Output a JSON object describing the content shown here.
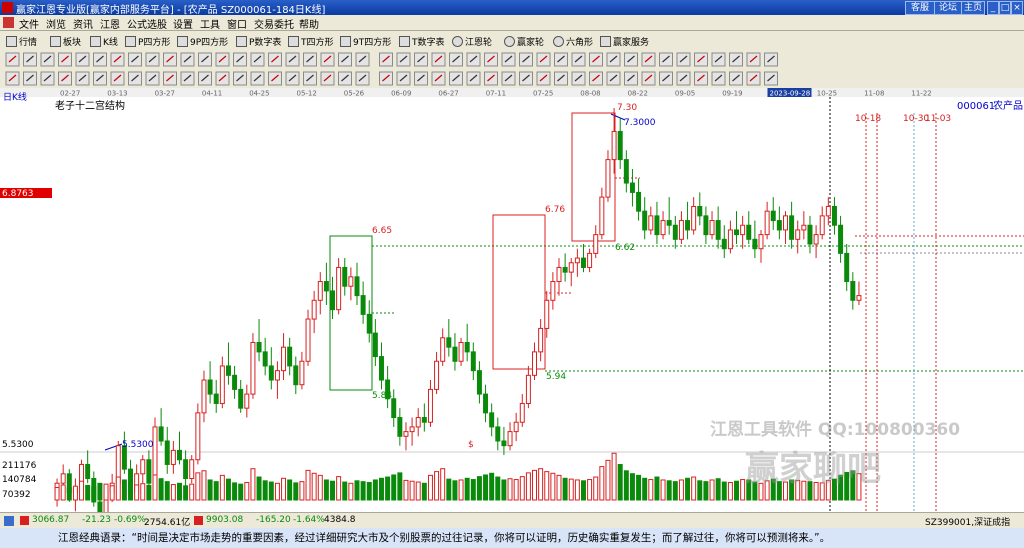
{
  "window": {
    "title": "赢家江恩专业版[赢家内部服务平台] - [农产品  SZ000061-184日K线]",
    "buttons": [
      "客服",
      "论坛",
      "主页"
    ],
    "win_controls": [
      "_",
      "□",
      "×"
    ]
  },
  "menu": [
    "文件",
    "浏览",
    "资讯",
    "江恩",
    "公式选股",
    "设置",
    "工具",
    "窗口",
    "交易委托",
    "帮助"
  ],
  "toolbar1": [
    {
      "icon": "grid-icon",
      "label": "行情"
    },
    {
      "icon": "blocks-icon",
      "label": "板块"
    },
    {
      "icon": "kline-icon",
      "label": "K线"
    },
    {
      "icon": "p-square-icon",
      "label": "P四方形"
    },
    {
      "icon": "9p-square-icon",
      "label": "9P四方形"
    },
    {
      "icon": "p-numtable-icon",
      "label": "P数字表"
    },
    {
      "icon": "t-square-icon",
      "label": "T四方形"
    },
    {
      "icon": "9t-square-icon",
      "label": "9T四方形"
    },
    {
      "icon": "t-numtable-icon",
      "label": "T数字表"
    },
    {
      "icon": "gann-wheel-icon",
      "label": "江恩轮"
    },
    {
      "icon": "winner-wheel-icon",
      "label": "赢家轮"
    },
    {
      "icon": "hexagon-icon",
      "label": "六角形"
    },
    {
      "icon": "service-icon",
      "label": "赢家服务"
    }
  ],
  "chart": {
    "period_label": "日K线",
    "structure_label": "老子十二宫结构",
    "stock_code": "000061",
    "stock_name": "农产品",
    "price_marker": "6.8763",
    "date_axis": [
      "02-27",
      "03-13",
      "03-27",
      "04-11",
      "04-25",
      "05-12",
      "05-26",
      "06-09",
      "06-27",
      "07-11",
      "07-25",
      "08-08",
      "08-22",
      "09-05",
      "09-19",
      "2023-09-28",
      "10-25",
      "11-08",
      "11-22"
    ],
    "future_dates": [
      "10-18",
      "10-30",
      "11-03"
    ],
    "annotations": [
      "7.30",
      "7.3000",
      "6.76",
      "6.65",
      "6.62",
      "5.94",
      "5.84",
      "5.5300",
      "5.5300",
      "$"
    ],
    "volume_ticks": [
      "211176",
      "140784",
      "70392"
    ],
    "chart_data": {
      "type": "candlestick",
      "symbol": "SZ000061",
      "ylim": [
        5.3,
        7.5
      ],
      "candles": [
        [
          5.66,
          5.72,
          5.6,
          5.7
        ],
        [
          5.7,
          5.78,
          5.66,
          5.74
        ],
        [
          5.74,
          5.76,
          5.62,
          5.66
        ],
        [
          5.66,
          5.72,
          5.58,
          5.68
        ],
        [
          5.68,
          5.8,
          5.66,
          5.78
        ],
        [
          5.78,
          5.84,
          5.7,
          5.72
        ],
        [
          5.72,
          5.75,
          5.6,
          5.62
        ],
        [
          5.62,
          5.66,
          5.53,
          5.56
        ],
        [
          5.56,
          5.68,
          5.54,
          5.66
        ],
        [
          5.66,
          5.74,
          5.62,
          5.7
        ],
        [
          5.7,
          5.88,
          5.68,
          5.86
        ],
        [
          5.86,
          5.92,
          5.74,
          5.76
        ],
        [
          5.76,
          5.8,
          5.64,
          5.66
        ],
        [
          5.66,
          5.78,
          5.64,
          5.74
        ],
        [
          5.74,
          5.82,
          5.7,
          5.8
        ],
        [
          5.8,
          5.84,
          5.68,
          5.7
        ],
        [
          5.7,
          5.98,
          5.68,
          5.94
        ],
        [
          5.94,
          6.02,
          5.86,
          5.88
        ],
        [
          5.88,
          5.94,
          5.74,
          5.78
        ],
        [
          5.78,
          5.88,
          5.74,
          5.84
        ],
        [
          5.84,
          5.92,
          5.78,
          5.8
        ],
        [
          5.8,
          5.84,
          5.68,
          5.72
        ],
        [
          5.72,
          5.82,
          5.7,
          5.8
        ],
        [
          5.8,
          6.04,
          5.78,
          6.0
        ],
        [
          6.0,
          6.18,
          5.96,
          6.14
        ],
        [
          6.14,
          6.22,
          6.04,
          6.08
        ],
        [
          6.08,
          6.14,
          6.0,
          6.04
        ],
        [
          6.04,
          6.24,
          6.02,
          6.2
        ],
        [
          6.2,
          6.3,
          6.12,
          6.16
        ],
        [
          6.16,
          6.2,
          6.06,
          6.1
        ],
        [
          6.1,
          6.14,
          6.0,
          6.02
        ],
        [
          6.02,
          6.12,
          5.98,
          6.08
        ],
        [
          6.08,
          6.34,
          6.06,
          6.3
        ],
        [
          6.3,
          6.4,
          6.22,
          6.26
        ],
        [
          6.26,
          6.32,
          6.16,
          6.2
        ],
        [
          6.2,
          6.28,
          6.1,
          6.14
        ],
        [
          6.14,
          6.22,
          6.06,
          6.18
        ],
        [
          6.18,
          6.34,
          6.14,
          6.28
        ],
        [
          6.28,
          6.32,
          6.16,
          6.2
        ],
        [
          6.2,
          6.24,
          6.08,
          6.12
        ],
        [
          6.12,
          6.26,
          6.1,
          6.22
        ],
        [
          6.22,
          6.44,
          6.2,
          6.4
        ],
        [
          6.4,
          6.52,
          6.34,
          6.48
        ],
        [
          6.48,
          6.6,
          6.42,
          6.56
        ],
        [
          6.56,
          6.64,
          6.46,
          6.52
        ],
        [
          6.52,
          6.58,
          6.4,
          6.44
        ],
        [
          6.44,
          6.66,
          6.42,
          6.62
        ],
        [
          6.62,
          6.66,
          6.5,
          6.54
        ],
        [
          6.54,
          6.62,
          6.48,
          6.58
        ],
        [
          6.58,
          6.64,
          6.46,
          6.5
        ],
        [
          6.5,
          6.56,
          6.38,
          6.42
        ],
        [
          6.42,
          6.48,
          6.3,
          6.34
        ],
        [
          6.34,
          6.4,
          6.2,
          6.24
        ],
        [
          6.24,
          6.3,
          6.1,
          6.14
        ],
        [
          6.14,
          6.2,
          6.02,
          6.06
        ],
        [
          6.06,
          6.1,
          5.94,
          5.98
        ],
        [
          5.98,
          6.02,
          5.86,
          5.9
        ],
        [
          5.9,
          5.96,
          5.84,
          5.92
        ],
        [
          5.92,
          5.98,
          5.86,
          5.94
        ],
        [
          5.94,
          6.02,
          5.9,
          5.98
        ],
        [
          5.98,
          6.04,
          5.92,
          5.96
        ],
        [
          5.96,
          6.14,
          5.94,
          6.1
        ],
        [
          6.1,
          6.26,
          6.08,
          6.22
        ],
        [
          6.22,
          6.36,
          6.2,
          6.32
        ],
        [
          6.32,
          6.4,
          6.24,
          6.28
        ],
        [
          6.28,
          6.34,
          6.18,
          6.22
        ],
        [
          6.22,
          6.32,
          6.2,
          6.3
        ],
        [
          6.3,
          6.38,
          6.22,
          6.26
        ],
        [
          6.26,
          6.3,
          6.14,
          6.18
        ],
        [
          6.18,
          6.22,
          6.04,
          6.08
        ],
        [
          6.08,
          6.12,
          5.96,
          6.0
        ],
        [
          6.0,
          6.04,
          5.9,
          5.94
        ],
        [
          5.94,
          5.98,
          5.84,
          5.88
        ],
        [
          5.88,
          5.94,
          5.82,
          5.86
        ],
        [
          5.86,
          5.96,
          5.84,
          5.92
        ],
        [
          5.92,
          6.0,
          5.88,
          5.96
        ],
        [
          5.96,
          6.08,
          5.94,
          6.04
        ],
        [
          6.04,
          6.2,
          6.02,
          6.16
        ],
        [
          6.16,
          6.3,
          6.14,
          6.26
        ],
        [
          6.26,
          6.4,
          6.22,
          6.36
        ],
        [
          6.36,
          6.52,
          6.32,
          6.48
        ],
        [
          6.48,
          6.6,
          6.44,
          6.56
        ],
        [
          6.56,
          6.66,
          6.5,
          6.62
        ],
        [
          6.62,
          6.68,
          6.56,
          6.6
        ],
        [
          6.6,
          6.66,
          6.54,
          6.64
        ],
        [
          6.64,
          6.7,
          6.58,
          6.66
        ],
        [
          6.66,
          6.72,
          6.6,
          6.62
        ],
        [
          6.62,
          6.7,
          6.6,
          6.68
        ],
        [
          6.68,
          6.8,
          6.66,
          6.76
        ],
        [
          6.76,
          6.96,
          6.74,
          6.92
        ],
        [
          6.92,
          7.12,
          6.9,
          7.08
        ],
        [
          7.08,
          7.3,
          7.02,
          7.2
        ],
        [
          7.2,
          7.26,
          7.04,
          7.08
        ],
        [
          7.08,
          7.12,
          6.94,
          6.98
        ],
        [
          6.98,
          7.04,
          6.88,
          6.94
        ],
        [
          6.94,
          7.0,
          6.82,
          6.86
        ],
        [
          6.86,
          6.92,
          6.74,
          6.78
        ],
        [
          6.78,
          6.88,
          6.76,
          6.84
        ],
        [
          6.84,
          6.9,
          6.72,
          6.76
        ],
        [
          6.76,
          6.86,
          6.74,
          6.82
        ],
        [
          6.82,
          6.92,
          6.76,
          6.8
        ],
        [
          6.8,
          6.84,
          6.7,
          6.74
        ],
        [
          6.74,
          6.86,
          6.72,
          6.82
        ],
        [
          6.82,
          6.9,
          6.74,
          6.78
        ],
        [
          6.78,
          6.92,
          6.76,
          6.88
        ],
        [
          6.88,
          6.94,
          6.8,
          6.84
        ],
        [
          6.84,
          6.88,
          6.72,
          6.76
        ],
        [
          6.76,
          6.86,
          6.74,
          6.82
        ],
        [
          6.82,
          6.88,
          6.7,
          6.74
        ],
        [
          6.74,
          6.8,
          6.66,
          6.7
        ],
        [
          6.7,
          6.82,
          6.68,
          6.78
        ],
        [
          6.78,
          6.86,
          6.72,
          6.76
        ],
        [
          6.76,
          6.84,
          6.7,
          6.8
        ],
        [
          6.8,
          6.86,
          6.72,
          6.74
        ],
        [
          6.74,
          6.82,
          6.66,
          6.7
        ],
        [
          6.7,
          6.78,
          6.64,
          6.76
        ],
        [
          6.76,
          6.9,
          6.74,
          6.86
        ],
        [
          6.86,
          6.92,
          6.78,
          6.82
        ],
        [
          6.82,
          6.88,
          6.74,
          6.78
        ],
        [
          6.78,
          6.86,
          6.72,
          6.84
        ],
        [
          6.84,
          6.9,
          6.7,
          6.74
        ],
        [
          6.74,
          6.82,
          6.68,
          6.78
        ],
        [
          6.78,
          6.86,
          6.74,
          6.8
        ],
        [
          6.8,
          6.84,
          6.68,
          6.72
        ],
        [
          6.72,
          6.8,
          6.66,
          6.76
        ],
        [
          6.76,
          6.88,
          6.74,
          6.84
        ],
        [
          6.84,
          6.92,
          6.8,
          6.88
        ],
        [
          6.88,
          6.92,
          6.76,
          6.8
        ],
        [
          6.8,
          6.84,
          6.64,
          6.68
        ],
        [
          6.68,
          6.72,
          6.52,
          6.56
        ],
        [
          6.56,
          6.6,
          6.44,
          6.48
        ],
        [
          6.48,
          6.56,
          6.46,
          6.5
        ]
      ],
      "volumes": [
        60,
        72,
        58,
        66,
        90,
        70,
        64,
        80,
        76,
        68,
        110,
        96,
        84,
        72,
        78,
        70,
        120,
        102,
        88,
        74,
        80,
        68,
        76,
        130,
        140,
        96,
        88,
        118,
        100,
        82,
        76,
        84,
        150,
        110,
        92,
        86,
        80,
        104,
        96,
        82,
        88,
        142,
        128,
        118,
        96,
        90,
        112,
        86,
        80,
        92,
        88,
        84,
        96,
        104,
        110,
        120,
        130,
        94,
        90,
        86,
        80,
        118,
        136,
        150,
        100,
        92,
        96,
        104,
        98,
        112,
        120,
        128,
        110,
        96,
        102,
        98,
        112,
        130,
        142,
        150,
        136,
        128,
        118,
        104,
        100,
        96,
        92,
        98,
        110,
        160,
        190,
        224,
        170,
        140,
        126,
        118,
        104,
        98,
        110,
        96,
        92,
        88,
        96,
        104,
        110,
        92,
        88,
        96,
        102,
        86,
        84,
        90,
        98,
        96,
        86,
        80,
        92,
        100,
        88,
        86,
        96,
        94,
        90,
        88,
        84,
        82,
        94,
        100,
        118,
        132,
        140,
        126
      ]
    }
  },
  "status": {
    "sh_index": "3066.87",
    "sh_change": "-21.23",
    "sh_pct": "-0.69%",
    "sh_amount": "2754.61亿",
    "sz_index": "9903.08",
    "sz_change": "-165.20",
    "sz_pct": "-1.64%",
    "sz_amount": "4384.8",
    "right": "SZ399001,深证成指"
  },
  "quote": "江恩经典语录：“时间是决定市场走势的重要因素，经过详细研究大市及个别股票的过往记录，你将可以证明，历史确实重复发生；而了解过往，你将可以预测将来。”。",
  "watermark": {
    "line1": "江恩工具软件 QQ:100800360",
    "line2": "赢家聊吧"
  },
  "colors": {
    "up": "#d82020",
    "down": "#0a8a0a",
    "titlebar": "#0a3aa0",
    "marker": "#e00000"
  }
}
